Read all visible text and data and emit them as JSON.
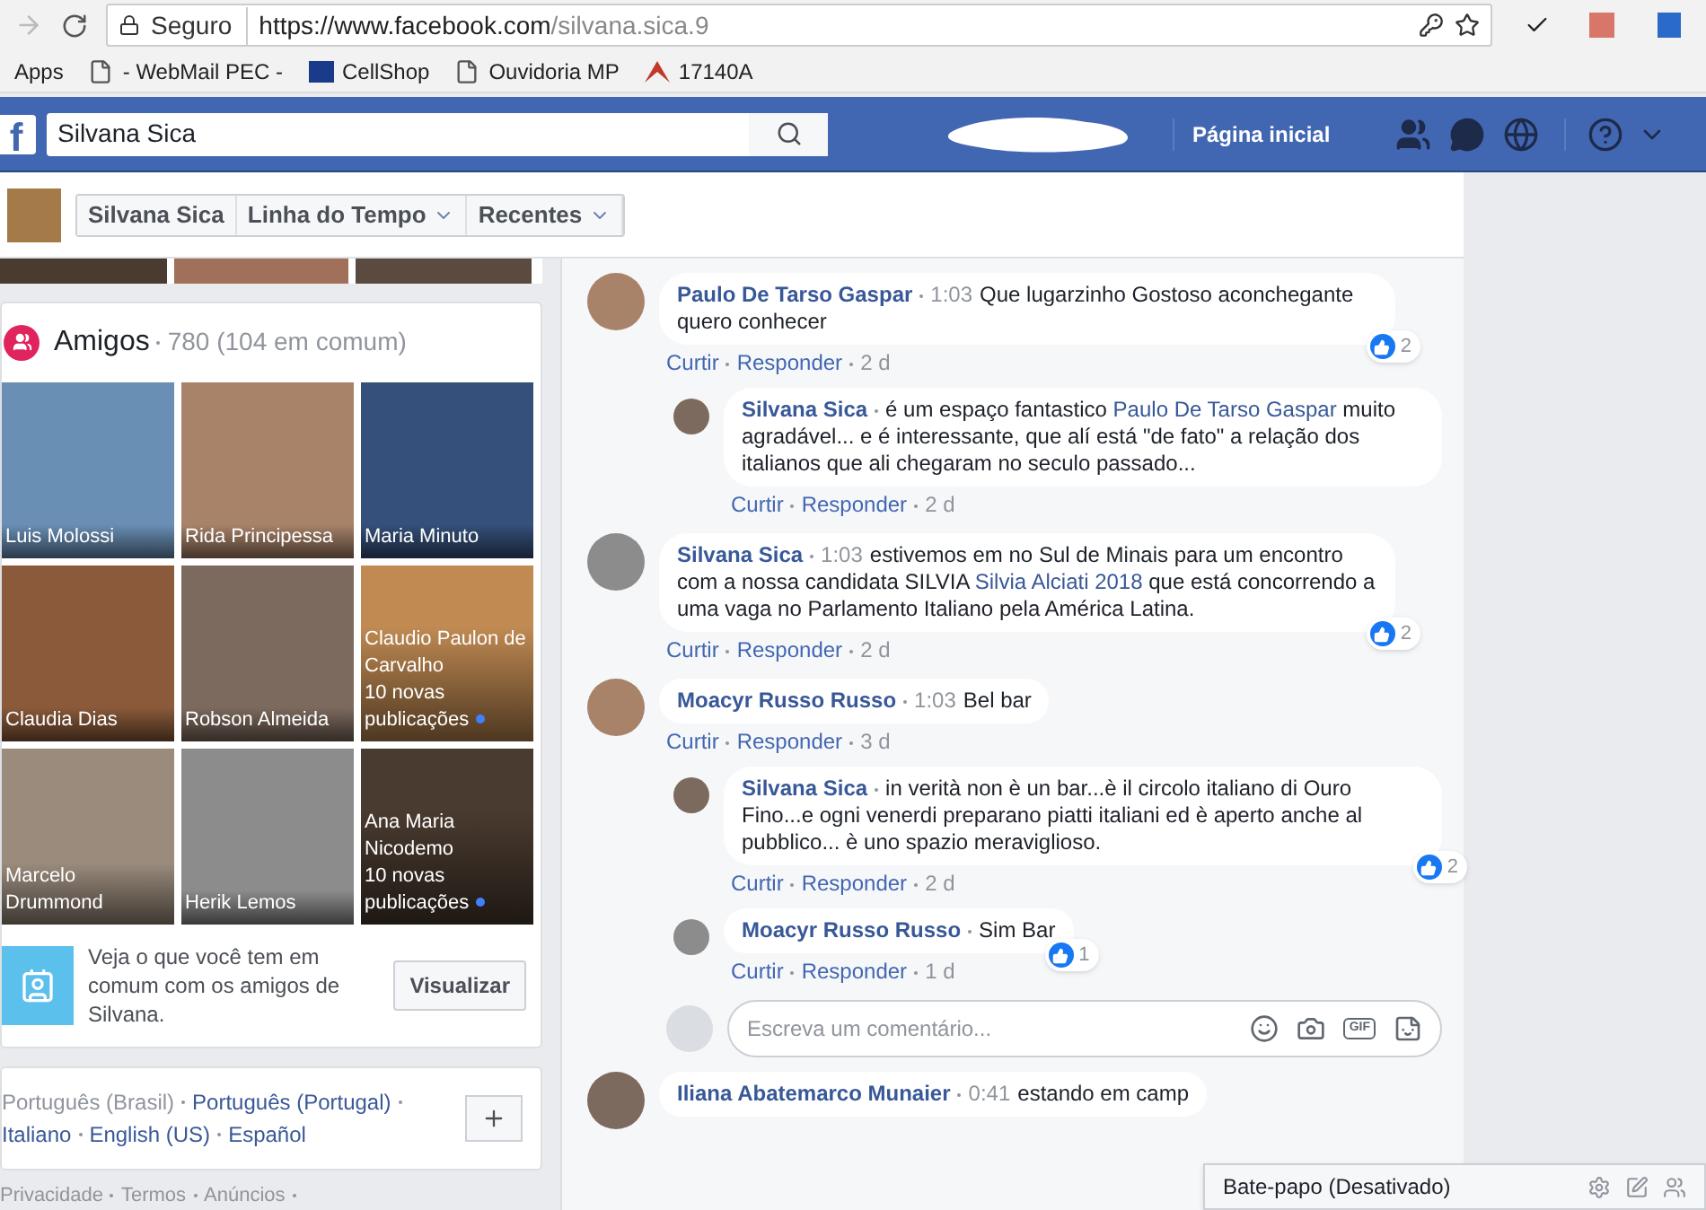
{
  "browser": {
    "security": "Seguro",
    "url_host": "https://www.facebook.com",
    "url_path": "/silvana.sica.9",
    "bookmarks": [
      {
        "kind": "apps",
        "label": "Apps"
      },
      {
        "kind": "page",
        "label": "- WebMail PEC -"
      },
      {
        "kind": "brand",
        "label": "CellShop"
      },
      {
        "kind": "page",
        "label": "Ouvidoria MP"
      },
      {
        "kind": "arrow",
        "label": "17140A"
      }
    ]
  },
  "topbar": {
    "logo": "f",
    "search_value": "Silvana Sica",
    "home": "Página inicial"
  },
  "profile_nav": {
    "tabs": [
      {
        "label": "Silvana Sica",
        "dropdown": false
      },
      {
        "label": "Linha do Tempo",
        "dropdown": true
      },
      {
        "label": "Recentes",
        "dropdown": true
      }
    ]
  },
  "friends": {
    "title": "Amigos",
    "count": "780 (104 em comum)",
    "tiles": [
      {
        "name": "Luis Molossi"
      },
      {
        "name": "Rida Principessa"
      },
      {
        "name": "Maria Minuto"
      },
      {
        "name": "Claudia Dias"
      },
      {
        "name": "Robson Almeida"
      },
      {
        "name": "Claudio Paulon de Carvalho",
        "note": "10 novas publicações",
        "unseen": true
      },
      {
        "name": "Marcelo Drummond"
      },
      {
        "name": "Herik Lemos"
      },
      {
        "name": "Ana Maria Nicodemo",
        "note": "10 novas publicações",
        "unseen": true
      }
    ],
    "prompt": "Veja o que você tem em comum com os amigos de Silvana.",
    "button": "Visualizar"
  },
  "languages": [
    {
      "label": "Português (Brasil)",
      "selected": true
    },
    {
      "label": "Português (Portugal)",
      "selected": false
    },
    {
      "label": "Italiano",
      "selected": false
    },
    {
      "label": "English (US)",
      "selected": false
    },
    {
      "label": "Español",
      "selected": false
    }
  ],
  "footer_links": [
    "Privacidade",
    "Termos",
    "Anúncios"
  ],
  "comments": [
    {
      "kind": "comment",
      "author": "Paulo De Tarso Gaspar",
      "time": "1:03",
      "text": [
        {
          "kind": "plain",
          "t": "Que lugarzinho Gostoso aconchegante quero conhecer"
        }
      ],
      "actions": {
        "like": "Curtir",
        "reply": "Responder",
        "age": "2 d"
      },
      "reactions": "2"
    },
    {
      "kind": "reply",
      "author": "Silvana Sica",
      "text": [
        {
          "kind": "plain",
          "t": "é um espaço fantastico "
        },
        {
          "kind": "mention",
          "t": "Paulo De Tarso Gaspar"
        },
        {
          "kind": "plain",
          "t": " muito agradável... e é interessante, que alí está \"de fato\" a relação dos italianos que ali chegaram no seculo passado..."
        }
      ],
      "actions": {
        "like": "Curtir",
        "reply": "Responder",
        "age": "2 d"
      }
    },
    {
      "kind": "comment",
      "author": "Silvana Sica",
      "time": "1:03",
      "text": [
        {
          "kind": "plain",
          "t": "estivemos em no Sul de Minais para um encontro com a nossa candidata SILVIA "
        },
        {
          "kind": "mention",
          "t": "Silvia Alciati 2018"
        },
        {
          "kind": "plain",
          "t": " que está concorrendo a uma vaga no Parlamento Italiano pela América Latina."
        }
      ],
      "actions": {
        "like": "Curtir",
        "reply": "Responder",
        "age": "2 d"
      },
      "reactions": "2"
    },
    {
      "kind": "comment",
      "author": "Moacyr Russo Russo",
      "time": "1:03",
      "text": [
        {
          "kind": "plain",
          "t": "Bel bar"
        }
      ],
      "actions": {
        "like": "Curtir",
        "reply": "Responder",
        "age": "3 d"
      }
    },
    {
      "kind": "reply",
      "author": "Silvana Sica",
      "text": [
        {
          "kind": "plain",
          "t": "in verità non è un bar...è il circolo italiano di Ouro Fino...e ogni venerdi preparano piatti italiani ed è aperto anche al pubblico... è uno spazio meraviglioso."
        }
      ],
      "actions": {
        "like": "Curtir",
        "reply": "Responder",
        "age": "2 d"
      },
      "reactions": "2"
    },
    {
      "kind": "reply",
      "author": "Moacyr Russo Russo",
      "text": [
        {
          "kind": "plain",
          "t": "Sim Bar"
        }
      ],
      "actions": {
        "like": "Curtir",
        "reply": "Responder",
        "age": "1 d"
      },
      "reactions": "1"
    },
    {
      "kind": "composer",
      "placeholder": "Escreva um comentário...",
      "gif": "GIF"
    },
    {
      "kind": "comment",
      "author": "Iliana Abatemarco Munaier",
      "time": "0:41",
      "text": [
        {
          "kind": "plain",
          "t": "estando em camp"
        }
      ]
    }
  ],
  "chat": {
    "label": "Bate-papo (Desativado)"
  }
}
